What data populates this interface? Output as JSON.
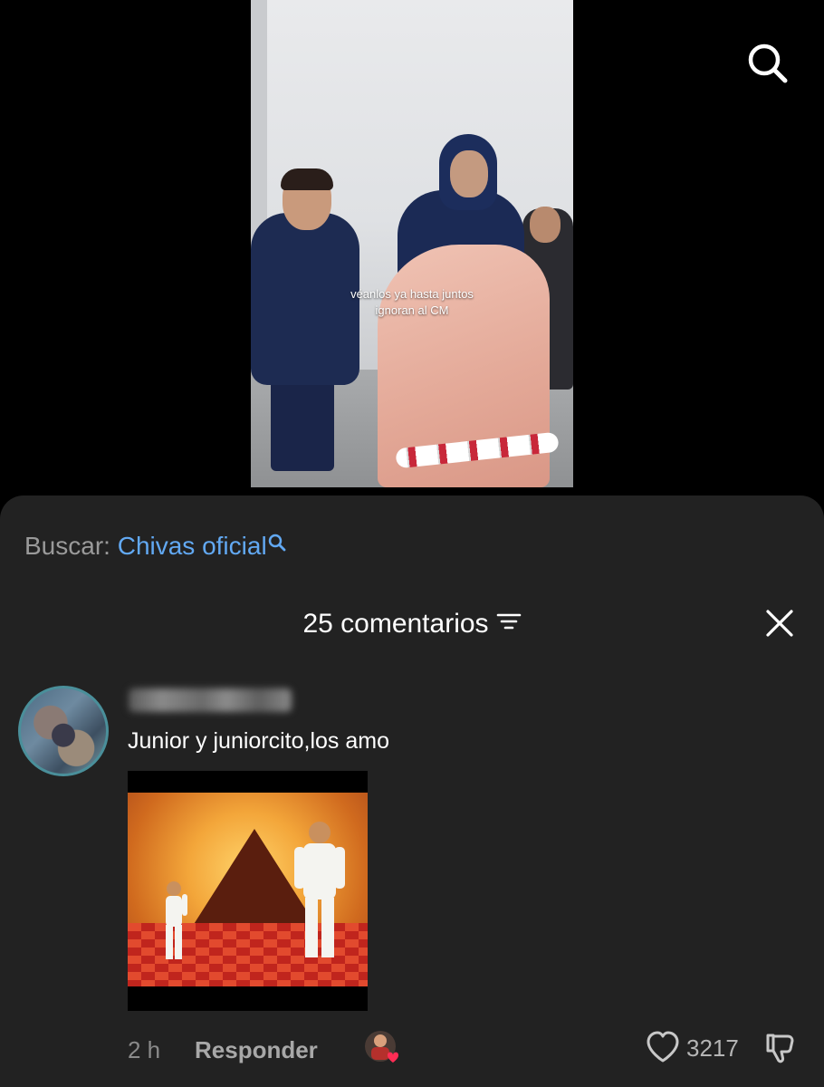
{
  "video": {
    "caption_lines": [
      "véanlos ya hasta juntos",
      "ignoran al CM"
    ]
  },
  "top_bar": {
    "search_icon": "search-icon"
  },
  "search_suggestion": {
    "label": "Buscar:",
    "query": "Chivas oficial",
    "icon": "search-icon",
    "query_color": "#62a9f3"
  },
  "comments_header": {
    "count_label": "25 comentarios",
    "sort_icon": "sort-icon",
    "close_icon": "close-icon"
  },
  "comments": [
    {
      "avatar": "avatar-pixelated",
      "username_hidden": true,
      "text": "Junior y juniorcito,los amo",
      "attachment": "gif-image",
      "time": "2 h",
      "reply_label": "Responder",
      "creator_liked_icon": "creator-heart-avatar-icon",
      "likes": "3217",
      "like_icon": "heart-outline-icon",
      "dislike_icon": "thumbs-down-icon"
    }
  ]
}
